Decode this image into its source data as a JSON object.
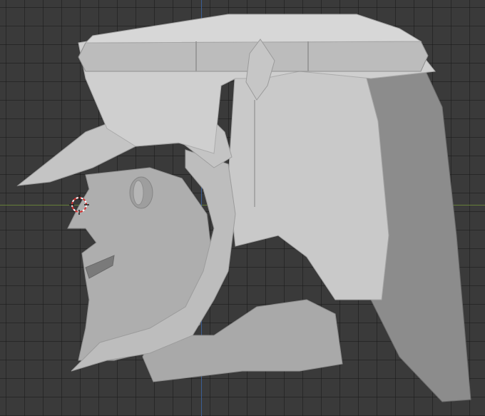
{
  "viewport": {
    "background": "#3a3a3a",
    "grid_color": "#2a2a2a",
    "axis_x_color": "#6f8b3a",
    "axis_z_color": "#3d65a5"
  },
  "model": {
    "subject": "helmeted-head-sculpt",
    "material_color": "#b8b8b8"
  },
  "cursor": {
    "icon": "3d-cursor-icon",
    "colors": [
      "#ffffff",
      "#d33030"
    ]
  }
}
